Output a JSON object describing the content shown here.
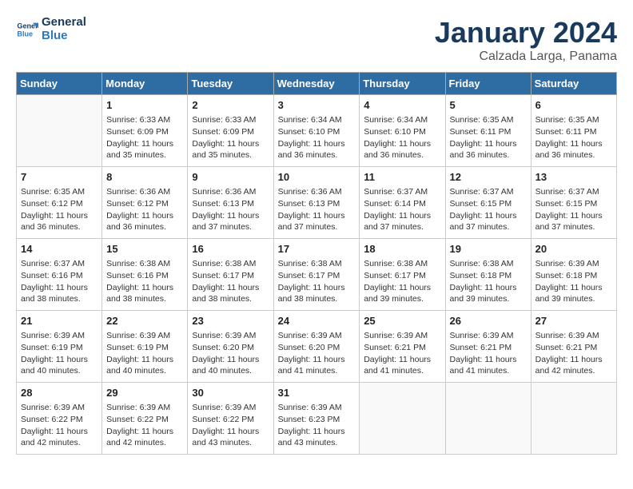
{
  "header": {
    "logo_line1": "General",
    "logo_line2": "Blue",
    "title": "January 2024",
    "subtitle": "Calzada Larga, Panama"
  },
  "weekdays": [
    "Sunday",
    "Monday",
    "Tuesday",
    "Wednesday",
    "Thursday",
    "Friday",
    "Saturday"
  ],
  "weeks": [
    [
      {
        "day": "",
        "info": ""
      },
      {
        "day": "1",
        "info": "Sunrise: 6:33 AM\nSunset: 6:09 PM\nDaylight: 11 hours\nand 35 minutes."
      },
      {
        "day": "2",
        "info": "Sunrise: 6:33 AM\nSunset: 6:09 PM\nDaylight: 11 hours\nand 35 minutes."
      },
      {
        "day": "3",
        "info": "Sunrise: 6:34 AM\nSunset: 6:10 PM\nDaylight: 11 hours\nand 36 minutes."
      },
      {
        "day": "4",
        "info": "Sunrise: 6:34 AM\nSunset: 6:10 PM\nDaylight: 11 hours\nand 36 minutes."
      },
      {
        "day": "5",
        "info": "Sunrise: 6:35 AM\nSunset: 6:11 PM\nDaylight: 11 hours\nand 36 minutes."
      },
      {
        "day": "6",
        "info": "Sunrise: 6:35 AM\nSunset: 6:11 PM\nDaylight: 11 hours\nand 36 minutes."
      }
    ],
    [
      {
        "day": "7",
        "info": "Sunrise: 6:35 AM\nSunset: 6:12 PM\nDaylight: 11 hours\nand 36 minutes."
      },
      {
        "day": "8",
        "info": "Sunrise: 6:36 AM\nSunset: 6:12 PM\nDaylight: 11 hours\nand 36 minutes."
      },
      {
        "day": "9",
        "info": "Sunrise: 6:36 AM\nSunset: 6:13 PM\nDaylight: 11 hours\nand 37 minutes."
      },
      {
        "day": "10",
        "info": "Sunrise: 6:36 AM\nSunset: 6:13 PM\nDaylight: 11 hours\nand 37 minutes."
      },
      {
        "day": "11",
        "info": "Sunrise: 6:37 AM\nSunset: 6:14 PM\nDaylight: 11 hours\nand 37 minutes."
      },
      {
        "day": "12",
        "info": "Sunrise: 6:37 AM\nSunset: 6:15 PM\nDaylight: 11 hours\nand 37 minutes."
      },
      {
        "day": "13",
        "info": "Sunrise: 6:37 AM\nSunset: 6:15 PM\nDaylight: 11 hours\nand 37 minutes."
      }
    ],
    [
      {
        "day": "14",
        "info": "Sunrise: 6:37 AM\nSunset: 6:16 PM\nDaylight: 11 hours\nand 38 minutes."
      },
      {
        "day": "15",
        "info": "Sunrise: 6:38 AM\nSunset: 6:16 PM\nDaylight: 11 hours\nand 38 minutes."
      },
      {
        "day": "16",
        "info": "Sunrise: 6:38 AM\nSunset: 6:17 PM\nDaylight: 11 hours\nand 38 minutes."
      },
      {
        "day": "17",
        "info": "Sunrise: 6:38 AM\nSunset: 6:17 PM\nDaylight: 11 hours\nand 38 minutes."
      },
      {
        "day": "18",
        "info": "Sunrise: 6:38 AM\nSunset: 6:17 PM\nDaylight: 11 hours\nand 39 minutes."
      },
      {
        "day": "19",
        "info": "Sunrise: 6:38 AM\nSunset: 6:18 PM\nDaylight: 11 hours\nand 39 minutes."
      },
      {
        "day": "20",
        "info": "Sunrise: 6:39 AM\nSunset: 6:18 PM\nDaylight: 11 hours\nand 39 minutes."
      }
    ],
    [
      {
        "day": "21",
        "info": "Sunrise: 6:39 AM\nSunset: 6:19 PM\nDaylight: 11 hours\nand 40 minutes."
      },
      {
        "day": "22",
        "info": "Sunrise: 6:39 AM\nSunset: 6:19 PM\nDaylight: 11 hours\nand 40 minutes."
      },
      {
        "day": "23",
        "info": "Sunrise: 6:39 AM\nSunset: 6:20 PM\nDaylight: 11 hours\nand 40 minutes."
      },
      {
        "day": "24",
        "info": "Sunrise: 6:39 AM\nSunset: 6:20 PM\nDaylight: 11 hours\nand 41 minutes."
      },
      {
        "day": "25",
        "info": "Sunrise: 6:39 AM\nSunset: 6:21 PM\nDaylight: 11 hours\nand 41 minutes."
      },
      {
        "day": "26",
        "info": "Sunrise: 6:39 AM\nSunset: 6:21 PM\nDaylight: 11 hours\nand 41 minutes."
      },
      {
        "day": "27",
        "info": "Sunrise: 6:39 AM\nSunset: 6:21 PM\nDaylight: 11 hours\nand 42 minutes."
      }
    ],
    [
      {
        "day": "28",
        "info": "Sunrise: 6:39 AM\nSunset: 6:22 PM\nDaylight: 11 hours\nand 42 minutes."
      },
      {
        "day": "29",
        "info": "Sunrise: 6:39 AM\nSunset: 6:22 PM\nDaylight: 11 hours\nand 42 minutes."
      },
      {
        "day": "30",
        "info": "Sunrise: 6:39 AM\nSunset: 6:22 PM\nDaylight: 11 hours\nand 43 minutes."
      },
      {
        "day": "31",
        "info": "Sunrise: 6:39 AM\nSunset: 6:23 PM\nDaylight: 11 hours\nand 43 minutes."
      },
      {
        "day": "",
        "info": ""
      },
      {
        "day": "",
        "info": ""
      },
      {
        "day": "",
        "info": ""
      }
    ]
  ]
}
